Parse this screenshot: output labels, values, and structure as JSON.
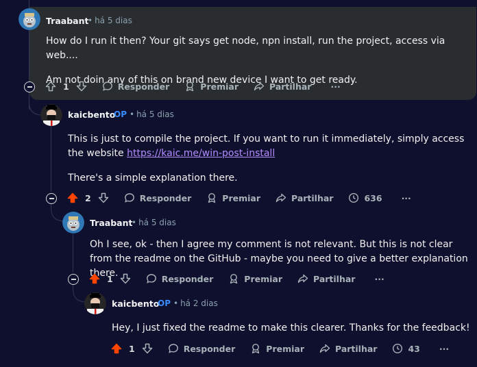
{
  "comments": [
    {
      "author": "Traabant",
      "op": "",
      "time": "há 5 dias",
      "paragraphs": [
        "How do I run it then? Your git says get node, npn install, run the project, access via web....",
        "Am not doin any of this on brand new device I want to get ready."
      ],
      "score": "1",
      "upvoted": false,
      "reply": "Responder",
      "award": "Premiar",
      "share": "Partilhar",
      "views": "",
      "more": "···"
    },
    {
      "author": "kaicbento",
      "op": "OP",
      "time": "há 5 dias",
      "p1_text": "This is just to compile the project. If you want to run it immediately, simply access the website ",
      "p1_link": "https://kaic.me/win-post-install",
      "p2": "There's a simple explanation there.",
      "score": "2",
      "upvoted": true,
      "reply": "Responder",
      "award": "Premiar",
      "share": "Partilhar",
      "views": "636",
      "more": "···"
    },
    {
      "author": "Traabant",
      "op": "",
      "time": "há 5 dias",
      "paragraphs": [
        "Oh I see, ok - then I agree my comment is not relevant. But this is not clear from the readme on the GitHub - maybe you need to give a better explanation there."
      ],
      "score": "1",
      "upvoted": true,
      "reply": "Responder",
      "award": "Premiar",
      "share": "Partilhar",
      "views": "",
      "more": "···"
    },
    {
      "author": "kaicbento",
      "op": "OP",
      "time": "há 2 dias",
      "paragraphs": [
        "Hey, I just fixed the readme to make this clearer. Thanks for the feedback!"
      ],
      "score": "1",
      "upvoted": true,
      "reply": "Responder",
      "award": "Premiar",
      "share": "Partilhar",
      "views": "43",
      "more": "···"
    }
  ],
  "colors": {
    "background": "#0f0f2e",
    "highlight": "#2a2d30",
    "upvote": "#ff4500",
    "op": "#3a8bff",
    "link": "#b38cff"
  },
  "icons": [
    "upvote-icon",
    "downvote-icon",
    "reply-icon",
    "award-icon",
    "share-icon",
    "views-icon",
    "collapse-icon"
  ]
}
